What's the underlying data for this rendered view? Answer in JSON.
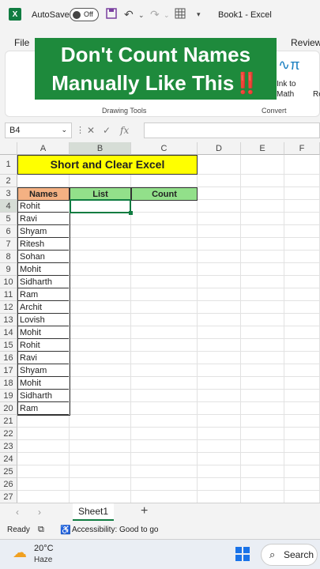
{
  "titlebar": {
    "logo": "X",
    "autosave_label": "AutoSave",
    "autosave_state": "Off",
    "doc_title": "Book1  -  Excel",
    "icons": [
      "save-icon",
      "undo-icon",
      "redo-icon",
      "table-icon",
      "customize-icon"
    ]
  },
  "menu": {
    "file": "File",
    "review": "Review"
  },
  "ribbon": {
    "drawing_tools_label": "Drawing Tools",
    "convert_label": "Convert",
    "ink_to_math": "Ink to Math",
    "re_label": "Re"
  },
  "overlay": {
    "line1": "Don't Count Names",
    "line2": "Manually Like This‼️"
  },
  "formula_bar": {
    "name_box": "B4",
    "fx": "fx",
    "value": ""
  },
  "columns": [
    "A",
    "B",
    "C",
    "D",
    "E",
    "F"
  ],
  "rows": [
    "1",
    "2",
    "3",
    "4",
    "5",
    "6",
    "7",
    "8",
    "9",
    "10",
    "11",
    "12",
    "13",
    "14",
    "15",
    "16",
    "17",
    "18",
    "19",
    "20",
    "21",
    "22",
    "23",
    "24",
    "25",
    "26",
    "27"
  ],
  "sheet": {
    "title": "Short and Clear Excel",
    "headers": {
      "names": "Names",
      "list": "List",
      "count": "Count"
    },
    "names": [
      "Rohit",
      "Ravi",
      "Shyam",
      "Ritesh",
      "Sohan",
      "Mohit",
      "Sidharth",
      "Ram",
      "Archit",
      "Lovish",
      "Mohit",
      "Rohit",
      "Ravi",
      "Shyam",
      "Mohit",
      "Sidharth",
      "Ram"
    ]
  },
  "tabs": {
    "sheet1": "Sheet1",
    "add": "+"
  },
  "status": {
    "ready": "Ready",
    "accessibility": "Accessibility: Good to go"
  },
  "taskbar": {
    "temp": "20°C",
    "weather": "Haze",
    "search": "Search"
  },
  "colors": {
    "excel_green": "#107c41",
    "title_fill": "#ffff00",
    "names_header_fill": "#f4b183",
    "list_header_fill": "#92e08a",
    "overlay_fill": "#1e8a3c"
  }
}
